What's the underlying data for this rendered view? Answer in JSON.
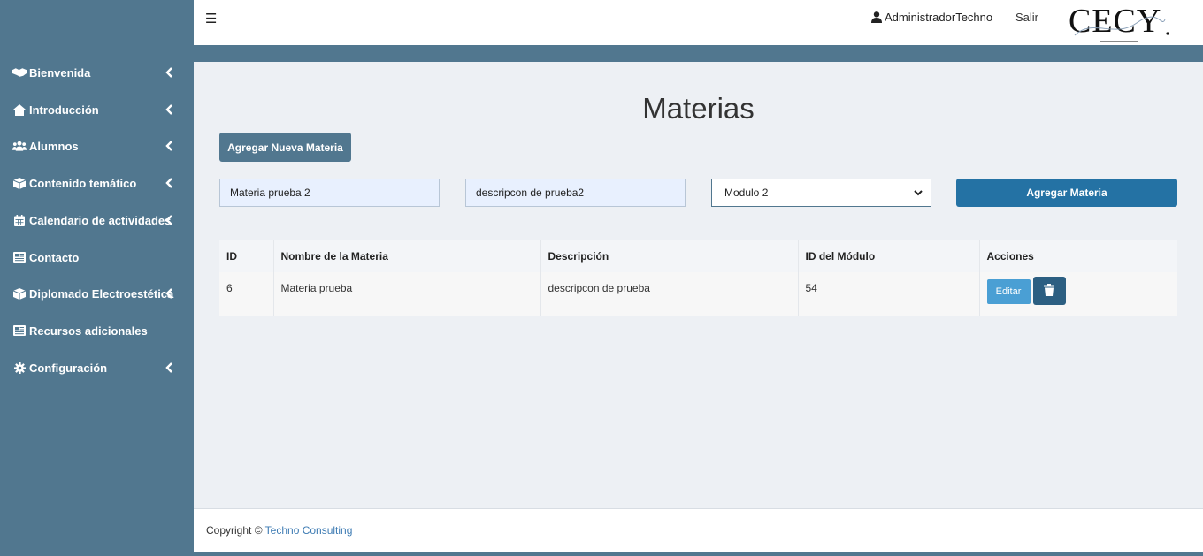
{
  "sidebar": {
    "items": [
      {
        "label": "Bienvenida",
        "icon": "handshake-icon"
      },
      {
        "label": "Introducción",
        "icon": "home-icon"
      },
      {
        "label": "Alumnos",
        "icon": "users-icon"
      },
      {
        "label": "Contenido temático",
        "icon": "box-icon"
      },
      {
        "label": "Calendario de actividades",
        "icon": "calendar-icon"
      },
      {
        "label": "Contacto",
        "icon": "newspaper-icon"
      },
      {
        "label": "Diplomado Electroestética",
        "icon": "box-icon"
      },
      {
        "label": "Recursos adicionales",
        "icon": "newspaper-icon"
      },
      {
        "label": "Configuración",
        "icon": "gear-icon"
      }
    ]
  },
  "header": {
    "user": "AdministradorTechno",
    "logout": "Salir",
    "logo": "CECY"
  },
  "main": {
    "title": "Materias",
    "new_button": "Agregar Nueva Materia",
    "form": {
      "name_value": "Materia prueba 2",
      "description_value": "descripcon de prueba2",
      "module_selected": "Modulo 2",
      "submit": "Agregar Materia"
    },
    "table": {
      "headers": [
        "ID",
        "Nombre de la Materia",
        "Descripción",
        "ID del Módulo",
        "Acciones"
      ],
      "rows": [
        {
          "id": "6",
          "name": "Materia prueba",
          "description": "descripcon de prueba",
          "module_id": "54",
          "edit": "Editar"
        }
      ]
    }
  },
  "footer": {
    "text": "Copyright ©",
    "link": "Techno Consulting"
  },
  "colors": {
    "sidebar": "#51778f",
    "primary": "#2472a4",
    "edit": "#4a9fd4",
    "delete": "#2c5f82"
  }
}
